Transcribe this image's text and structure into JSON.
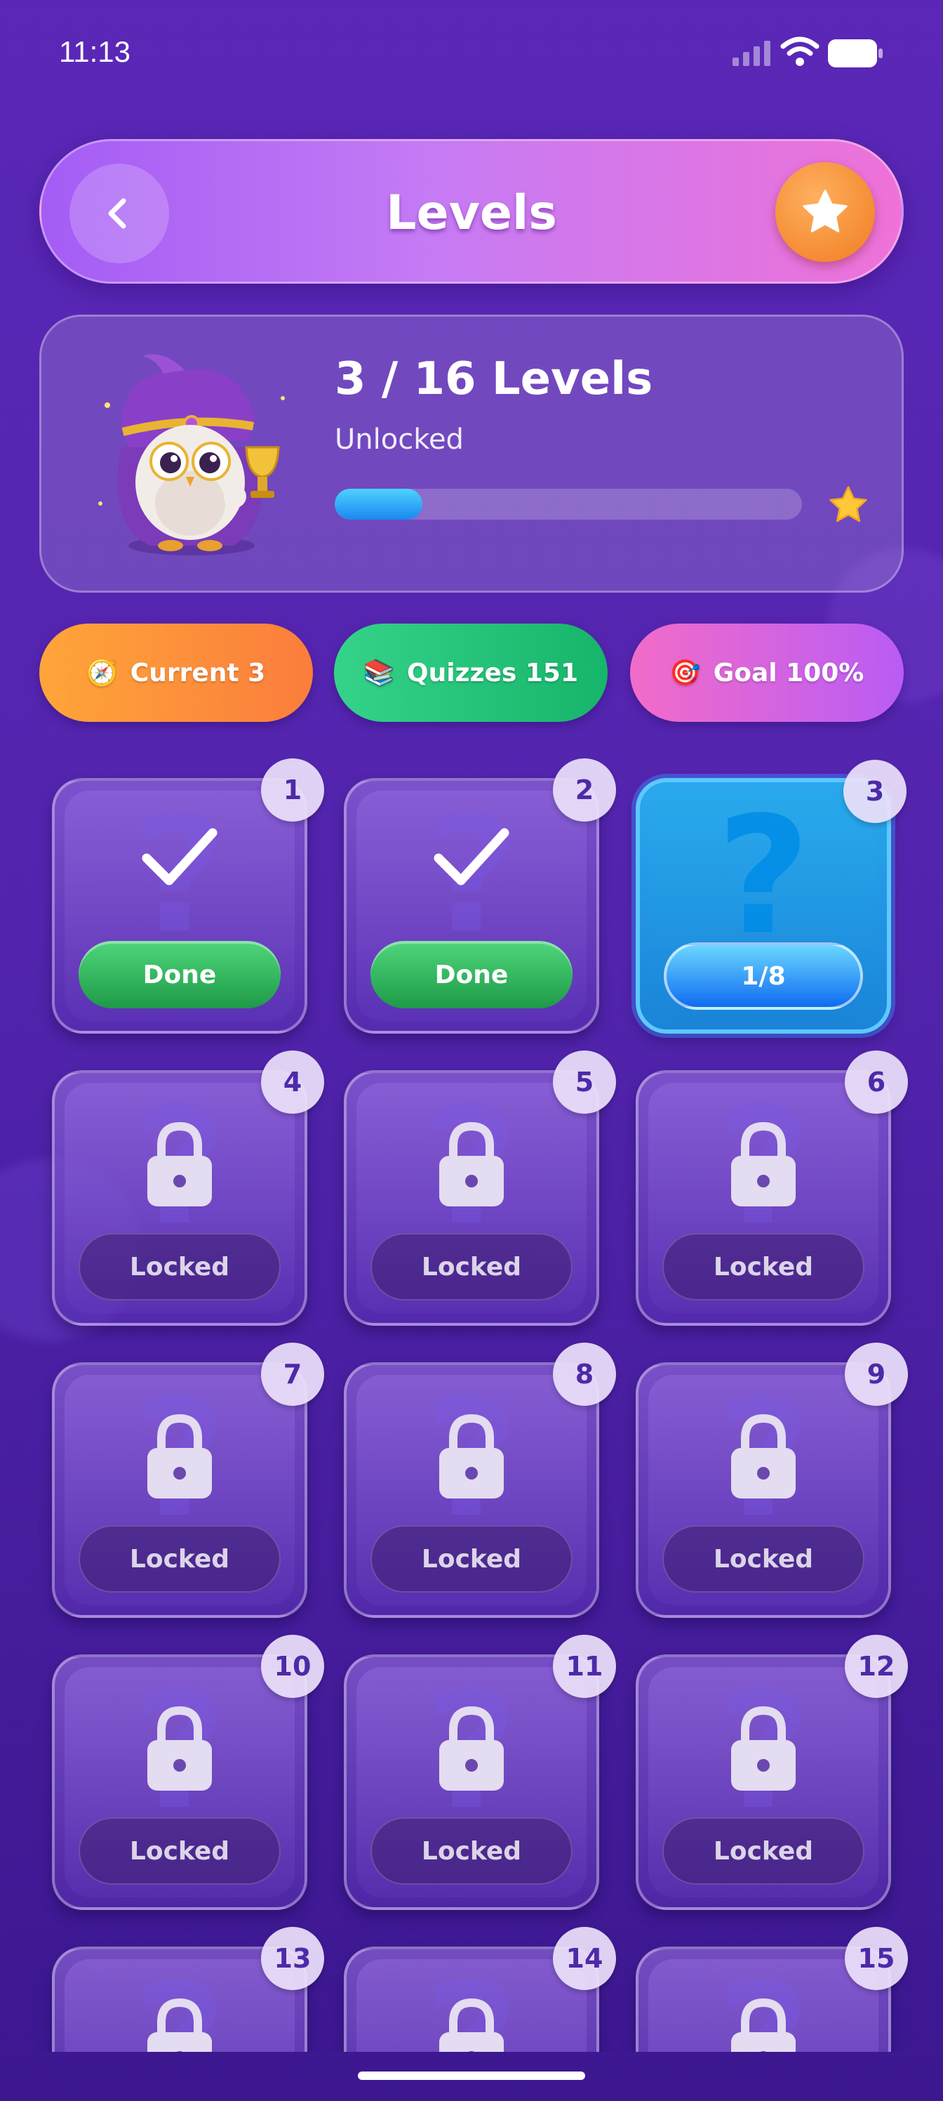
{
  "status_bar": {
    "time": "11:13"
  },
  "header": {
    "title": "Levels",
    "back_icon": "chevron-left-icon",
    "star_icon": "star-icon"
  },
  "progress": {
    "count_label": "3 / 16 Levels",
    "sub_label": "Unlocked",
    "fraction": 0.1875
  },
  "chips": [
    {
      "icon": "compass-icon",
      "emoji": "🧭",
      "label": "Current 3"
    },
    {
      "icon": "books-icon",
      "emoji": "📚",
      "label": "Quizzes 151"
    },
    {
      "icon": "target-icon",
      "emoji": "🎯",
      "label": "Goal 100%"
    }
  ],
  "levels": [
    {
      "number": "1",
      "state": "done",
      "label": "Done"
    },
    {
      "number": "2",
      "state": "done",
      "label": "Done"
    },
    {
      "number": "3",
      "state": "current",
      "label": "1/8"
    },
    {
      "number": "4",
      "state": "locked",
      "label": "Locked"
    },
    {
      "number": "5",
      "state": "locked",
      "label": "Locked"
    },
    {
      "number": "6",
      "state": "locked",
      "label": "Locked"
    },
    {
      "number": "7",
      "state": "locked",
      "label": "Locked"
    },
    {
      "number": "8",
      "state": "locked",
      "label": "Locked"
    },
    {
      "number": "9",
      "state": "locked",
      "label": "Locked"
    },
    {
      "number": "10",
      "state": "locked",
      "label": "Locked"
    },
    {
      "number": "11",
      "state": "locked",
      "label": "Locked"
    },
    {
      "number": "12",
      "state": "locked",
      "label": "Locked"
    },
    {
      "number": "13",
      "state": "locked",
      "label": ""
    },
    {
      "number": "14",
      "state": "locked",
      "label": ""
    },
    {
      "number": "15",
      "state": "locked",
      "label": ""
    }
  ],
  "colors": {
    "background": "#5224ad",
    "accent_orange": "#f07c1f",
    "done_green": "#1e9a48",
    "active_blue": "#1b84d8"
  }
}
